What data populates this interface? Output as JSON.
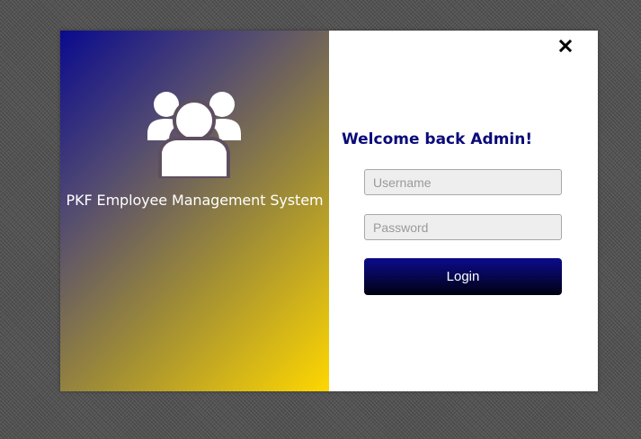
{
  "branding": {
    "app_title": "PKF Employee Management System",
    "icon": "users-group-icon"
  },
  "login": {
    "welcome": "Welcome back Admin!",
    "username_placeholder": "Username",
    "username_value": "",
    "password_placeholder": "Password",
    "password_value": "",
    "login_label": "Login",
    "close_icon": "close-icon"
  },
  "colors": {
    "accent": "#0a0a7a",
    "gradient_start": "#0a0a8e",
    "gradient_end": "#ffd700",
    "button_top": "#0b0b8c",
    "button_bottom": "#000010"
  }
}
